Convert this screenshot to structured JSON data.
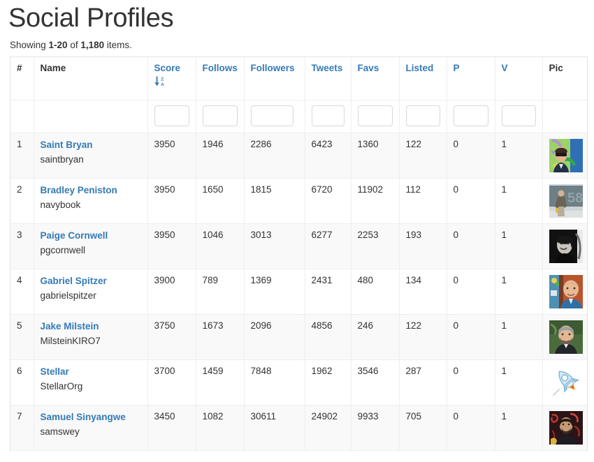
{
  "page": {
    "title": "Social Profiles",
    "summary_prefix": "Showing ",
    "summary_range": "1-20",
    "summary_mid": " of ",
    "summary_total": "1,180",
    "summary_suffix": " items."
  },
  "colors": {
    "link": "#337ab7",
    "text": "#333333",
    "stripe": "#f9f9f9",
    "border": "#eeeeee"
  },
  "table": {
    "headers": {
      "rank": "#",
      "name": "Name",
      "score": "Score",
      "follows": "Follows",
      "followers": "Followers",
      "tweets": "Tweets",
      "favs": "Favs",
      "listed": "Listed",
      "p": "P",
      "v": "V",
      "pic": "Pic"
    },
    "sort": {
      "column": "score",
      "direction": "desc",
      "icon": "sort-amount-desc-icon",
      "icon_top_letter": "Z",
      "icon_bottom_letter": "A"
    },
    "filters": {
      "score": "",
      "follows": "",
      "followers": "",
      "tweets": "",
      "favs": "",
      "listed": "",
      "p": "",
      "v": "",
      "placeholder": ""
    },
    "rows": [
      {
        "rank": "1",
        "name": "Saint Bryan",
        "handle": "saintbryan",
        "score": "3950",
        "follows": "1946",
        "followers": "2286",
        "tweets": "6423",
        "favs": "1360",
        "listed": "122",
        "p": "0",
        "v": "1",
        "pic": "avatar-photo-graffiti-sunglasses"
      },
      {
        "rank": "2",
        "name": "Bradley Peniston",
        "handle": "navybook",
        "score": "3950",
        "follows": "1650",
        "followers": "1815",
        "tweets": "6720",
        "favs": "11902",
        "listed": "112",
        "p": "0",
        "v": "1",
        "pic": "avatar-photo-chalkboard-58"
      },
      {
        "rank": "3",
        "name": "Paige Cornwell",
        "handle": "pgcornwell",
        "score": "3950",
        "follows": "1046",
        "followers": "3013",
        "tweets": "6277",
        "favs": "2253",
        "listed": "193",
        "p": "0",
        "v": "1",
        "pic": "avatar-photo-bw-portrait"
      },
      {
        "rank": "4",
        "name": "Gabriel Spitzer",
        "handle": "gabrielspitzer",
        "score": "3900",
        "follows": "789",
        "followers": "1369",
        "tweets": "2431",
        "favs": "480",
        "listed": "134",
        "p": "0",
        "v": "1",
        "pic": "avatar-photo-bald-blue-shirt"
      },
      {
        "rank": "5",
        "name": "Jake Milstein",
        "handle": "MilsteinKIRO7",
        "score": "3750",
        "follows": "1673",
        "followers": "2096",
        "tweets": "4856",
        "favs": "246",
        "listed": "122",
        "p": "0",
        "v": "1",
        "pic": "avatar-photo-beard-suit"
      },
      {
        "rank": "6",
        "name": "Stellar",
        "handle": "StellarOrg",
        "score": "3700",
        "follows": "1459",
        "followers": "7848",
        "tweets": "1962",
        "favs": "3546",
        "listed": "287",
        "p": "0",
        "v": "1",
        "pic": "avatar-rocket-logo"
      },
      {
        "rank": "7",
        "name": "Samuel Sinyangwe",
        "handle": "samswey",
        "score": "3450",
        "follows": "1082",
        "followers": "30611",
        "tweets": "24902",
        "favs": "9933",
        "listed": "705",
        "p": "0",
        "v": "1",
        "pic": "avatar-photo-red-graffiti-wall"
      }
    ]
  }
}
